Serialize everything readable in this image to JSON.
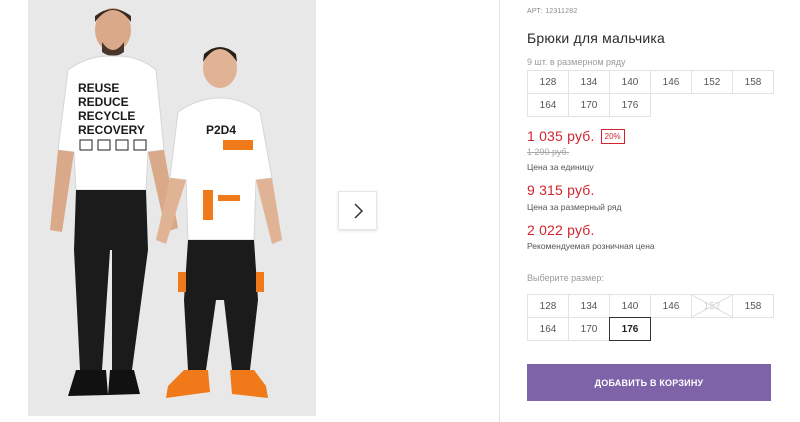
{
  "gallery": {
    "shirt_adult_lines": [
      "REUSE",
      "REDUCE",
      "RECYCLE",
      "RECOVERY"
    ],
    "shirt_child_text": "P2D4"
  },
  "product": {
    "article": "АРТ: 12311282",
    "title": "Брюки для мальчика",
    "series_note": "9 шт. в размерном ряду",
    "series_sizes": [
      "128",
      "134",
      "140",
      "146",
      "152",
      "158",
      "164",
      "170",
      "176"
    ],
    "price": "1 035 руб.",
    "discount": "20%",
    "old_price": "1 290 руб.",
    "price_unit_caption": "Цена за единицу",
    "series_price": "9 315 руб.",
    "series_price_caption": "Цена за размерный ряд",
    "rrp_price": "2 022 руб.",
    "rrp_caption": "Рекомендуемая розничная цена",
    "choose_label": "Выберите размер:",
    "choose_sizes": [
      {
        "label": "128",
        "state": "available"
      },
      {
        "label": "134",
        "state": "available"
      },
      {
        "label": "140",
        "state": "available"
      },
      {
        "label": "146",
        "state": "available"
      },
      {
        "label": "152",
        "state": "disabled"
      },
      {
        "label": "158",
        "state": "available"
      },
      {
        "label": "164",
        "state": "available"
      },
      {
        "label": "170",
        "state": "available"
      },
      {
        "label": "176",
        "state": "selected"
      }
    ],
    "add_to_cart": "ДОБАВИТЬ В КОРЗИНУ"
  },
  "colors": {
    "price_red": "#d1242f",
    "button_purple": "#7e63a8"
  },
  "icons": {
    "next": "chevron-right-icon"
  }
}
